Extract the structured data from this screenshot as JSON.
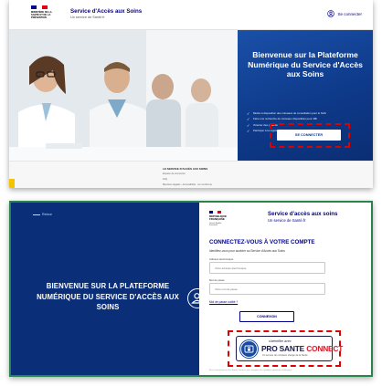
{
  "colors": {
    "republic_blue": "#000091",
    "republic_red": "#e1000f",
    "hero_blue": "#0e3a8a",
    "login_blue": "#0a2f78",
    "highlight_red": "#e00000",
    "frame_green": "#29834a"
  },
  "top_screen": {
    "header": {
      "ministry": "MINISTÈRE DE LA SANTÉ ET DE LA PRÉVENTION",
      "title": "Service d'Accès aux Soins",
      "subtitle": "Un service de Santé.fr",
      "login_link": "Se connecter",
      "login_icon": "user-circle-icon"
    },
    "hero": {
      "title": "Bienvenue sur la Plateforme Numérique du Service d'Accès aux Soins",
      "bullets": [
        "Mettre à disposition des créneaux de consultation pour le SAS",
        "Faire une recherche de créneaux disponibles pour 48h",
        "Orienter des patients",
        "Participer à la régulation"
      ],
      "connect_button": "SE CONNECTER"
    },
    "footer": {
      "title": "LE SERVICE D'ACCÈS AUX SOINS",
      "lines": [
        "Espace de connexion",
        "FAQ",
        "Mentions légales - Accessibilité : non conforme"
      ]
    }
  },
  "bottom_screen": {
    "back_link": "Retour",
    "headline": "BIENVENUE SUR LA PLATEFORME NUMÉRIQUE DU SERVICE D'ACCÈS AUX SOINS",
    "user_icon": "user-icon",
    "brand": {
      "republic": "RÉPUBLIQUE FRANÇAISE",
      "motto": "Liberté Égalité Fraternité"
    },
    "service_title": "Service d'accès aux soins",
    "service_subtitle": "Un service de Santé.fr",
    "connect_title": "CONNECTEZ-VOUS À VOTRE COMPTE",
    "intro": "Identifiez-vous pour accéder au Service d'Accès aux Soins",
    "email_label": "Adresse électronique",
    "email_placeholder": "Votre adresse électronique",
    "password_label": "Mot de passe",
    "password_placeholder": "Votre mot de passe",
    "forgot_link": "Mot de passe oublié ?",
    "submit_button": "CONNEXION",
    "psc": {
      "small": "s'identifier avec",
      "brand_pre": "PRO SANTE ",
      "brand_accent": "CONNECT",
      "tagline": "Un service du ministère chargé de la Santé",
      "icon": "card-lock-icon"
    },
    "fine_print": "En se connectant via Pro Santé Connect, vous acceptez les conditions générales d'utilisation"
  }
}
